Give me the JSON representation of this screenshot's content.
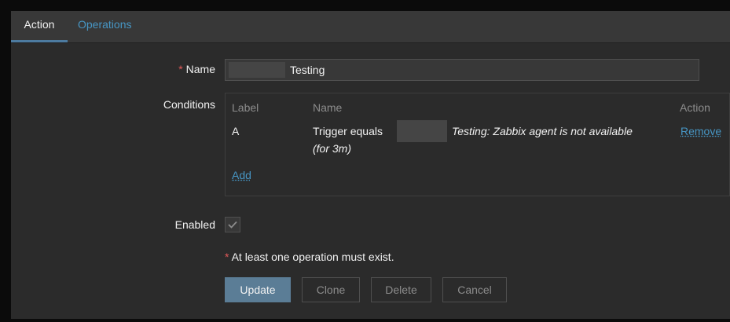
{
  "tabs": [
    {
      "label": "Action"
    },
    {
      "label": "Operations"
    }
  ],
  "form": {
    "name_label": "Name",
    "name_value": "Testing",
    "conditions_label": "Conditions",
    "enabled_label": "Enabled",
    "enabled": true
  },
  "conditions": {
    "headers": {
      "label": "Label",
      "name": "Name",
      "action": "Action"
    },
    "rows": [
      {
        "label": "A",
        "name_prefix": "Trigger equals",
        "name_italic": "Testing: Zabbix agent is not available",
        "name_line2": "(for 3m)",
        "action": "Remove"
      }
    ],
    "add_label": "Add"
  },
  "note": "At least one operation must exist.",
  "buttons": {
    "update": "Update",
    "clone": "Clone",
    "delete": "Delete",
    "cancel": "Cancel"
  },
  "colors": {
    "accent": "#4796c4",
    "required": "#e45959",
    "primary_button": "#5b7d96"
  }
}
